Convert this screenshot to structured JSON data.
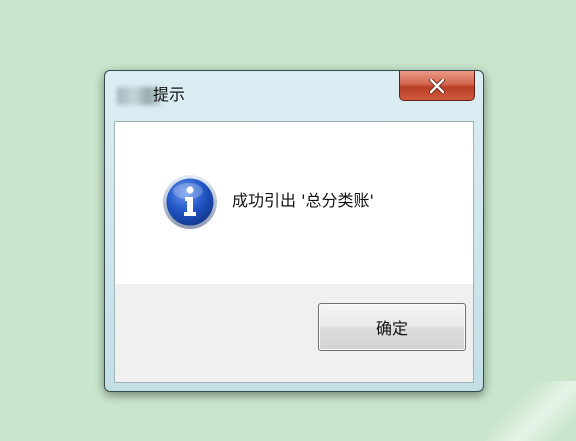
{
  "dialog": {
    "title": "提示",
    "message": "成功引出 '总分类账'",
    "ok_label": "确定"
  },
  "icons": {
    "title_icon": "blurred-app-icon",
    "close": "close-icon",
    "message_icon": "info-icon"
  },
  "colors": {
    "background": "#c9e6cc",
    "close_button": "#c94a30",
    "info_icon": "#1c4fb6"
  }
}
